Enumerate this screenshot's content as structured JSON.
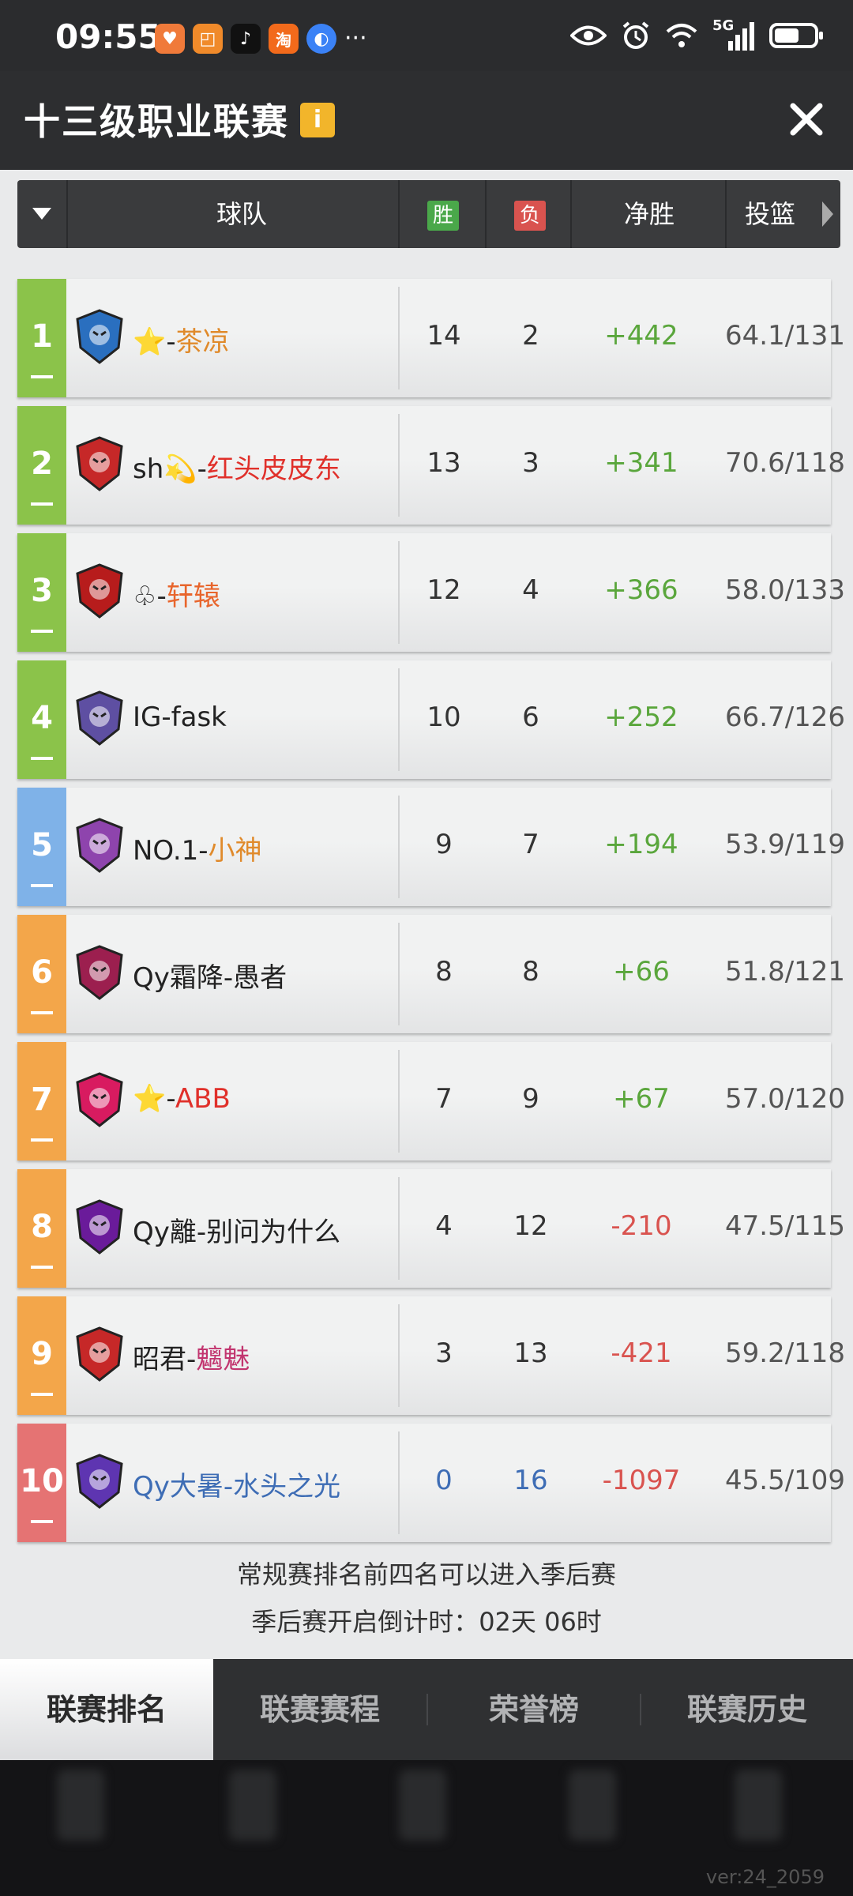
{
  "status_bar": {
    "time": "09:55",
    "more": "···",
    "network": "5G"
  },
  "header": {
    "title": "十三级职业联赛",
    "info_icon": "i"
  },
  "table": {
    "col_team": "球队",
    "col_win": "胜",
    "col_loss": "负",
    "col_net": "净胜",
    "col_shooting": "投篮"
  },
  "teams": [
    {
      "rank": "1",
      "prefix": "⭐",
      "sep": "-",
      "name": "茶凉",
      "wins": "14",
      "losses": "2",
      "net": "+442",
      "shoot": "64.1/131",
      "rank_color": "#8bc34a",
      "name_color": "#e08a2b",
      "logo_color": "#2a6fbf"
    },
    {
      "rank": "2",
      "prefix": "sh💫",
      "sep": "-",
      "name": "红头皮皮东",
      "wins": "13",
      "losses": "3",
      "net": "+341",
      "shoot": "70.6/118",
      "rank_color": "#8bc34a",
      "name_color": "#e0302a",
      "logo_color": "#c62828"
    },
    {
      "rank": "3",
      "prefix": "♧",
      "sep": "-",
      "name": "轩辕",
      "wins": "12",
      "losses": "4",
      "net": "+366",
      "shoot": "58.0/133",
      "rank_color": "#8bc34a",
      "name_color": "#e8652c",
      "logo_color": "#b71c1c"
    },
    {
      "rank": "4",
      "prefix": "IG",
      "sep": "-",
      "name": "fask",
      "wins": "10",
      "losses": "6",
      "net": "+252",
      "shoot": "66.7/126",
      "rank_color": "#8bc34a",
      "name_color": "#222222",
      "logo_color": "#5e4fa2"
    },
    {
      "rank": "5",
      "prefix": "NO.1",
      "sep": "-",
      "name": "小神",
      "wins": "9",
      "losses": "7",
      "net": "+194",
      "shoot": "53.9/119",
      "rank_color": "#7fb2e8",
      "name_color": "#e08a2b",
      "logo_color": "#8e44ad"
    },
    {
      "rank": "6",
      "prefix": "Qy霜降",
      "sep": "-",
      "name": "愚者",
      "wins": "8",
      "losses": "8",
      "net": "+66",
      "shoot": "51.8/121",
      "rank_color": "#f3a64a",
      "name_color": "#222222",
      "logo_color": "#9c1f4f"
    },
    {
      "rank": "7",
      "prefix": "⭐",
      "sep": "-",
      "name": "ABB",
      "wins": "7",
      "losses": "9",
      "net": "+67",
      "shoot": "57.0/120",
      "rank_color": "#f3a64a",
      "name_color": "#e0302a",
      "logo_color": "#d81b60"
    },
    {
      "rank": "8",
      "prefix": "Qy離",
      "sep": "-",
      "name": "别问为什么",
      "wins": "4",
      "losses": "12",
      "net": "-210",
      "shoot": "47.5/115",
      "rank_color": "#f3a64a",
      "name_color": "#222222",
      "logo_color": "#6a1b9a"
    },
    {
      "rank": "9",
      "prefix": "昭君",
      "sep": "-",
      "name": "魑魅",
      "wins": "3",
      "losses": "13",
      "net": "-421",
      "shoot": "59.2/118",
      "rank_color": "#f3a64a",
      "name_color": "#c2356f",
      "logo_color": "#c62828"
    },
    {
      "rank": "10",
      "prefix": "Qy大暑",
      "sep": "-",
      "name": "水头之光",
      "wins": "0",
      "losses": "16",
      "net": "-1097",
      "shoot": "45.5/109",
      "rank_color": "#e57373",
      "name_color": "#3e6db5",
      "logo_color": "#5e35b1"
    }
  ],
  "notes": {
    "line1": "常规赛排名前四名可以进入季后赛",
    "line2": "季后赛开启倒计时：02天 06时"
  },
  "tabs": [
    "联赛排名",
    "联赛赛程",
    "荣誉榜",
    "联赛历史"
  ],
  "version": "ver:24_2059"
}
